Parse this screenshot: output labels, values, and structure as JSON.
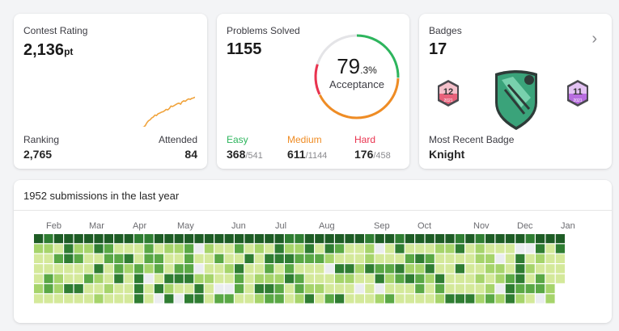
{
  "contest": {
    "title": "Contest Rating",
    "rating": "2,136",
    "rating_unit": "pt",
    "ranking_label": "Ranking",
    "ranking_value": "2,765",
    "attended_label": "Attended",
    "attended_value": "84",
    "line_color": "#f0a33c",
    "chart_data": {
      "type": "line",
      "values": [
        1500,
        1500,
        1500,
        1500,
        1500,
        1500,
        1500,
        1500,
        1500,
        1500,
        1500,
        1500,
        1500,
        1500,
        1500,
        1500,
        1500,
        1500,
        1500,
        1500,
        1500,
        1500,
        1500,
        1500,
        1500,
        1500,
        1500,
        1500,
        1500,
        1500,
        1500,
        1500,
        1500,
        1500,
        1500,
        1500,
        1500,
        1500,
        1500,
        1500,
        1500,
        1500,
        1500,
        1500,
        1500,
        1500,
        1500,
        1500,
        1500,
        1500,
        1500,
        1500,
        1500,
        1500,
        1500,
        1500,
        1500,
        1500,
        1500,
        1500,
        1500,
        1500,
        1500,
        1500,
        1500,
        1500,
        1500,
        1500,
        1500,
        1500,
        1500,
        1500,
        1500,
        1500,
        1500,
        1505,
        1540,
        1600,
        1640,
        1660,
        1700,
        1720,
        1760,
        1750,
        1790,
        1800,
        1820,
        1830,
        1850,
        1880,
        1870,
        1900,
        1950,
        1940,
        1960,
        1980,
        2000,
        2010,
        1990,
        2040,
        2060,
        2050,
        2080,
        2100,
        2090,
        2110,
        2120,
        2136
      ]
    }
  },
  "problems": {
    "title": "Problems Solved",
    "solved": "1155",
    "acceptance_int": "79",
    "acceptance_dec": ".3%",
    "acceptance_label": "Acceptance",
    "acceptance_rate": 0.793,
    "ring_segments": [
      {
        "color": "#2db55d",
        "share": 0.32
      },
      {
        "color": "#ef8c24",
        "share": 0.53
      },
      {
        "color": "#e9334f",
        "share": 0.15
      }
    ],
    "easy": {
      "label": "Easy",
      "solved": "368",
      "total": "/541",
      "color": "#2db55d"
    },
    "medium": {
      "label": "Medium",
      "solved": "611",
      "total": "/1144",
      "color": "#ef8c24"
    },
    "hard": {
      "label": "Hard",
      "solved": "176",
      "total": "/458",
      "color": "#e9334f"
    }
  },
  "badges": {
    "title": "Badges",
    "count": "17",
    "chevron": "›",
    "items": [
      {
        "name": "december-badge-icon",
        "number": "12",
        "year": "2021",
        "color": "#e8627b"
      },
      {
        "name": "knight-badge-icon",
        "color": "#3aa37a"
      },
      {
        "name": "november-badge-icon",
        "number": "11",
        "year": "2021",
        "color": "#b86ee0"
      }
    ],
    "recent_label": "Most Recent Badge",
    "recent_value": "Knight"
  },
  "submissions": {
    "title": "1952 submissions in the last year",
    "months": [
      "Feb",
      "Mar",
      "Apr",
      "May",
      "Jun",
      "Jul",
      "Aug",
      "Sep",
      "Oct",
      "Nov",
      "Dec",
      "Jan"
    ],
    "levels": [
      "#ebedf0",
      "#d4e99a",
      "#a6d46b",
      "#5aa845",
      "#2f7d32",
      "#1e5c25"
    ],
    "weeks": 53
  }
}
